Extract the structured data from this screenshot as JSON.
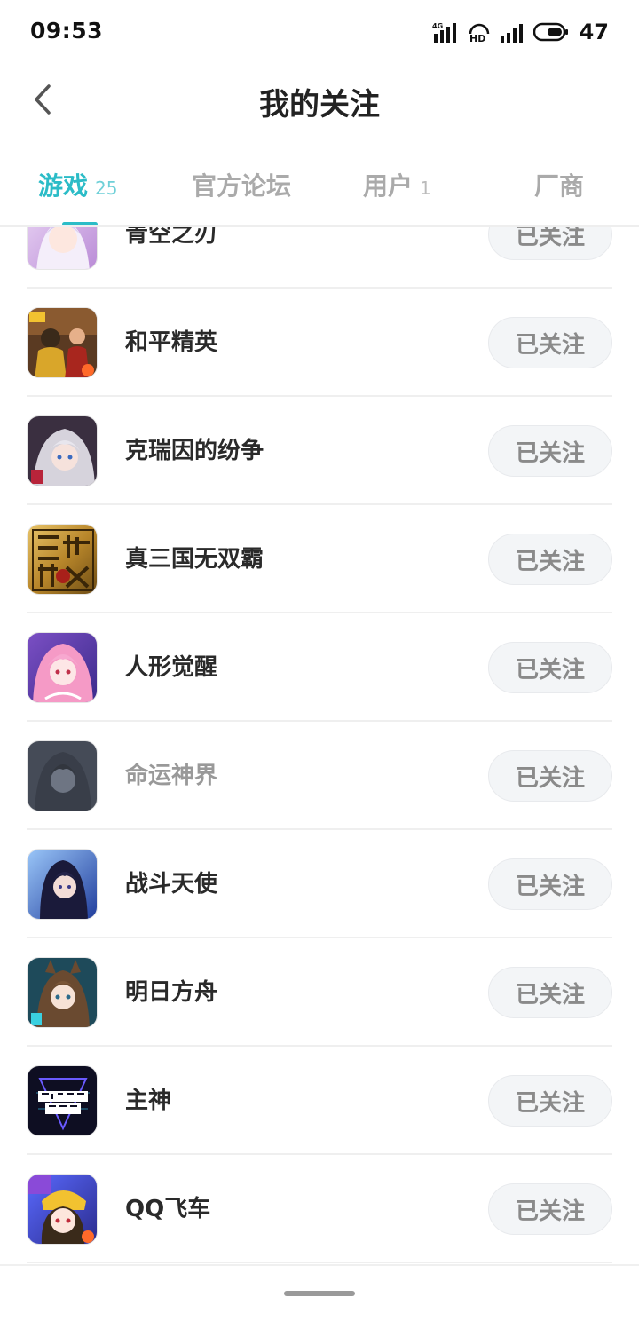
{
  "status_bar": {
    "time": "09:53",
    "network_label": "4G",
    "hd_label": "HD",
    "battery": "47"
  },
  "header": {
    "title": "我的关注",
    "back_icon": "chevron-left-icon"
  },
  "tabs": [
    {
      "label": "游戏",
      "count": "25",
      "active": true
    },
    {
      "label": "官方论坛",
      "count": "",
      "active": false
    },
    {
      "label": "用户",
      "count": "1",
      "active": false
    },
    {
      "label": "厂商",
      "count": "",
      "active": false
    }
  ],
  "colors": {
    "accent": "#2bbcc7",
    "button_bg": "#f3f5f7",
    "button_text": "#8a8a8a"
  },
  "follow_label": "已关注",
  "games": [
    {
      "name": "青空之刃",
      "icon": "anime-girl-icon",
      "dim": false
    },
    {
      "name": "和平精英",
      "icon": "soldier-icon",
      "dim": false
    },
    {
      "name": "克瑞因的纷争",
      "icon": "anime-girl-icon",
      "dim": false
    },
    {
      "name": "真三国无双霸",
      "icon": "gold-emblem-icon",
      "dim": false
    },
    {
      "name": "人形觉醒",
      "icon": "anime-girl-icon",
      "dim": false
    },
    {
      "name": "命运神界",
      "icon": "anime-girl-icon",
      "dim": true
    },
    {
      "name": "战斗天使",
      "icon": "anime-girl-icon",
      "dim": false
    },
    {
      "name": "明日方舟",
      "icon": "anime-girl-icon",
      "dim": false
    },
    {
      "name": "主神",
      "icon": "chief-god-logo-icon",
      "dim": false
    },
    {
      "name": "QQ飞车",
      "icon": "racer-girl-icon",
      "dim": false
    }
  ]
}
